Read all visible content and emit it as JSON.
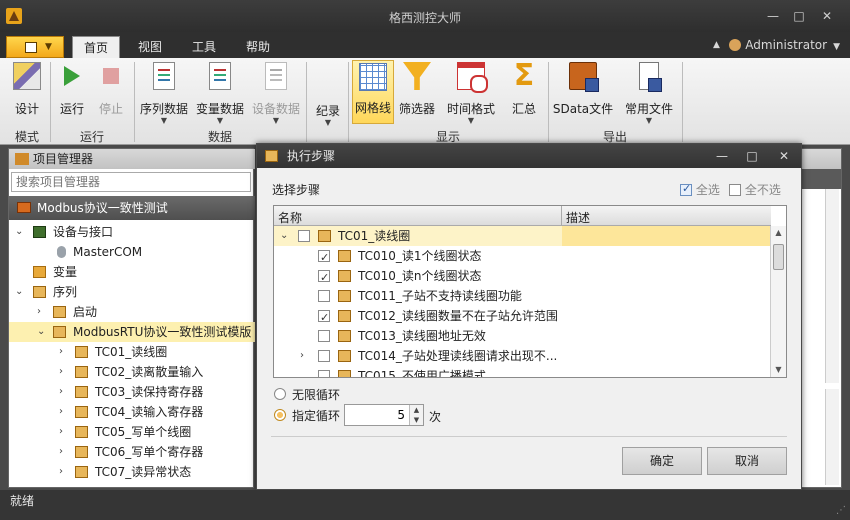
{
  "window": {
    "title": "格西测控大师"
  },
  "ribbon_tabs": [
    {
      "label": "首页",
      "active": true
    },
    {
      "label": "视图"
    },
    {
      "label": "工具"
    },
    {
      "label": "帮助"
    }
  ],
  "user": {
    "name": "Administrator"
  },
  "ribbon": {
    "design": "设计",
    "run": "运行",
    "stop": "停止",
    "seq_data": "序列数据",
    "var_data": "变量数据",
    "dev_data": "设备数据",
    "record": "纪录",
    "grid_line": "网格线",
    "filter": "筛选器",
    "time_format": "时间格式",
    "summary": "汇总",
    "sdata_file": "SData文件",
    "common_file": "常用文件",
    "groups": {
      "mode": "模式",
      "run": "运行",
      "data": "数据",
      "display": "显示",
      "export": "导出"
    }
  },
  "project_manager": {
    "title": "项目管理器",
    "search_placeholder": "搜索项目管理器",
    "project": "Modbus协议一致性测试",
    "tree": [
      {
        "label": "设备与接口"
      },
      {
        "label": "MasterCOM"
      },
      {
        "label": "变量"
      },
      {
        "label": "序列"
      },
      {
        "label": "启动"
      },
      {
        "label": "ModbusRTU协议一致性测试模版"
      },
      {
        "label": "TC01_读线圈"
      },
      {
        "label": "TC02_读离散量输入"
      },
      {
        "label": "TC03_读保持寄存器"
      },
      {
        "label": "TC04_读输入寄存器"
      },
      {
        "label": "TC05_写单个线圈"
      },
      {
        "label": "TC06_写单个寄存器"
      },
      {
        "label": "TC07_读异常状态"
      }
    ]
  },
  "dialog": {
    "title": "执行步骤",
    "section": "选择步骤",
    "select_all": "全选",
    "deselect_all": "全不选",
    "col_name": "名称",
    "col_desc": "描述",
    "rows": [
      {
        "label": "TC01_读线圈",
        "checked": false
      },
      {
        "label": "TC010_读1个线圈状态",
        "checked": true
      },
      {
        "label": "TC010_读n个线圈状态",
        "checked": true
      },
      {
        "label": "TC011_子站不支持读线圈功能",
        "checked": false
      },
      {
        "label": "TC012_读线圈数量不在子站允许范围",
        "checked": true
      },
      {
        "label": "TC013_读线圈地址无效",
        "checked": false
      },
      {
        "label": "TC014_子站处理读线圈请求出现不...",
        "checked": false
      },
      {
        "label": "TC015_不使用广播模式",
        "checked": false
      }
    ],
    "loop_infinite": "无限循环",
    "loop_fixed": "指定循环",
    "loop_count": "5",
    "loop_unit": "次",
    "ok": "确定",
    "cancel": "取消"
  },
  "status": {
    "text": "就绪"
  }
}
